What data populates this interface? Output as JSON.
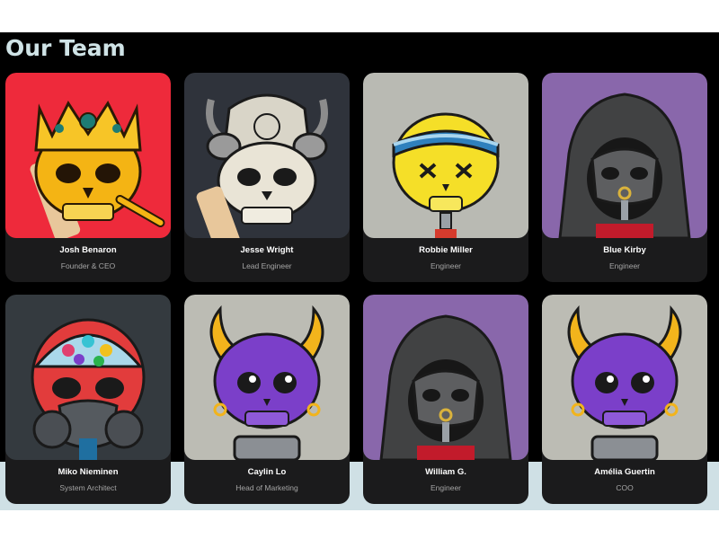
{
  "team": {
    "title": "Our Team",
    "members": [
      {
        "name": "Josh Benaron",
        "role": "Founder & CEO",
        "avatar": "gold-skull-with-crown",
        "background": "#ee2a3b"
      },
      {
        "name": "Jesse Wright",
        "role": "Lead Engineer",
        "avatar": "horned-skull-with-headdress",
        "background": "#2f333b"
      },
      {
        "name": "Robbie Miller",
        "role": "Engineer",
        "avatar": "yellow-skull-with-visor",
        "background": "#b9bab3"
      },
      {
        "name": "Blue Kirby",
        "role": "Engineer",
        "avatar": "hooded-reaper-skull",
        "background": "#8967ab"
      },
      {
        "name": "Miko Nieminen",
        "role": "System Architect",
        "avatar": "gas-mask-skull-with-candy-brain",
        "background": "#343a3f"
      },
      {
        "name": "Caylin Lo",
        "role": "Head of Marketing",
        "avatar": "purple-demon-skull",
        "background": "#bcbcb4"
      },
      {
        "name": "William G.",
        "role": "Engineer",
        "avatar": "hooded-reaper-skull",
        "background": "#8967ab"
      },
      {
        "name": "Amélia Guertin",
        "role": "COO",
        "avatar": "purple-demon-skull",
        "background": "#bcbcb4"
      }
    ]
  }
}
